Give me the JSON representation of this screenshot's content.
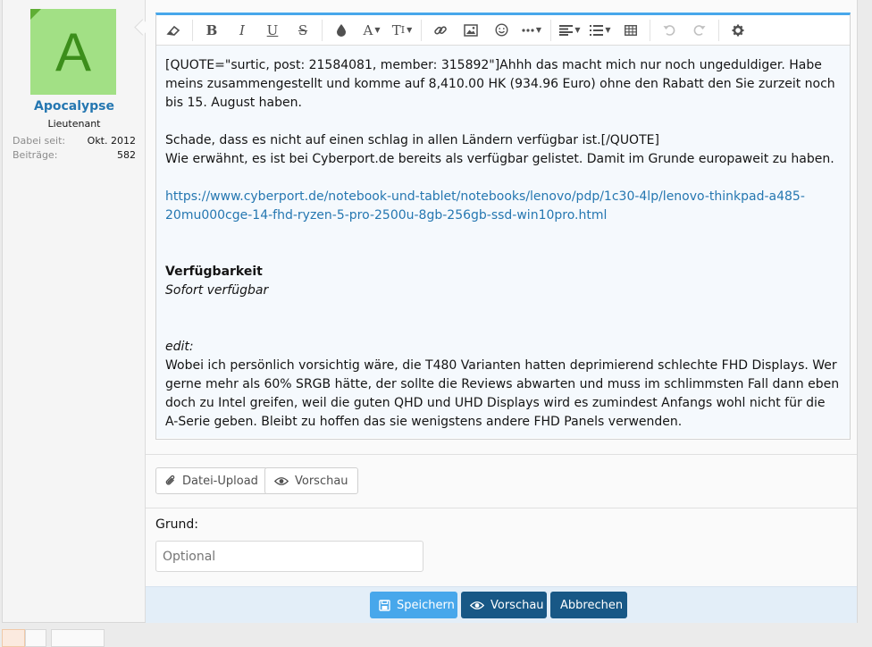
{
  "user": {
    "avatar_letter": "A",
    "name": "Apocalypse",
    "title": "Lieutenant",
    "stats": [
      {
        "label": "Dabei seit:",
        "value": "Okt. 2012"
      },
      {
        "label": "Beiträge:",
        "value": "582"
      }
    ]
  },
  "toolbar": {
    "buttons": [
      {
        "name": "eraser-icon",
        "label": "remove-formatting"
      },
      {
        "name": "bold-icon",
        "label": "B"
      },
      {
        "name": "italic-icon",
        "label": "I"
      },
      {
        "name": "underline-icon",
        "label": "U"
      },
      {
        "name": "strikethrough-icon",
        "label": "S"
      },
      {
        "name": "color-drop-icon",
        "label": "text-color"
      },
      {
        "name": "font-family-icon",
        "label": "A"
      },
      {
        "name": "font-size-icon",
        "label": "TI"
      },
      {
        "name": "link-icon",
        "label": "link"
      },
      {
        "name": "image-icon",
        "label": "image"
      },
      {
        "name": "smiley-icon",
        "label": "smilies"
      },
      {
        "name": "more-icon",
        "label": "more"
      },
      {
        "name": "align-icon",
        "label": "align"
      },
      {
        "name": "list-icon",
        "label": "list"
      },
      {
        "name": "table-icon",
        "label": "table"
      },
      {
        "name": "undo-icon",
        "label": "undo"
      },
      {
        "name": "redo-icon",
        "label": "redo"
      },
      {
        "name": "settings-icon",
        "label": "settings"
      }
    ]
  },
  "editor": {
    "quote_text": "[QUOTE=\"surtic, post: 21584081, member: 315892\"]Ahhh das macht mich nur noch ungeduldiger. Habe meins zusammengestellt und komme auf 8,410.00 HK (934.96 Euro) ohne den Rabatt den Sie zurzeit noch bis 15. August haben.",
    "quote_end": "Schade, dass es nicht auf einen schlag in allen Ländern verfügbar ist.[/QUOTE]",
    "line_cyberport": "Wie erwähnt, es ist bei Cyberport.de bereits als verfügbar gelistet. Damit im Grunde europaweit zu haben.",
    "link_text": "https://www.cyberport.de/notebook-und-tablet/notebooks/lenovo/pdp/1c30-4lp/lenovo-thinkpad-a485-20mu000cge-14-fhd-ryzen-5-pro-2500u-8gb-256gb-ssd-win10pro.html",
    "availability_heading": "Verfügbarkeit",
    "availability_value": "Sofort verfügbar",
    "edit_label": "edit:",
    "edit_text": "Wobei ich persönlich vorsichtig wäre, die T480 Varianten hatten deprimierend schlechte FHD Displays. Wer gerne mehr als 60% SRGB hätte, der sollte die Reviews abwarten und muss im schlimmsten Fall dann eben doch zu Intel greifen, weil die guten QHD und UHD Displays wird es zumindest Anfangs wohl nicht für die A-Serie geben. Bleibt zu hoffen das sie wenigstens andere FHD Panels verwenden."
  },
  "attachments": {
    "upload_label": "Datei-Upload",
    "preview_label": "Vorschau"
  },
  "reason": {
    "label": "Grund:",
    "placeholder": "Optional"
  },
  "actions": {
    "save_label": "Speichern",
    "preview_label": "Vorschau",
    "cancel_label": "Abbrechen"
  },
  "colors": {
    "accent": "#47a7eb",
    "dark_button": "#185886",
    "link": "#2577b1",
    "avatar_bg": "#a2e085"
  }
}
